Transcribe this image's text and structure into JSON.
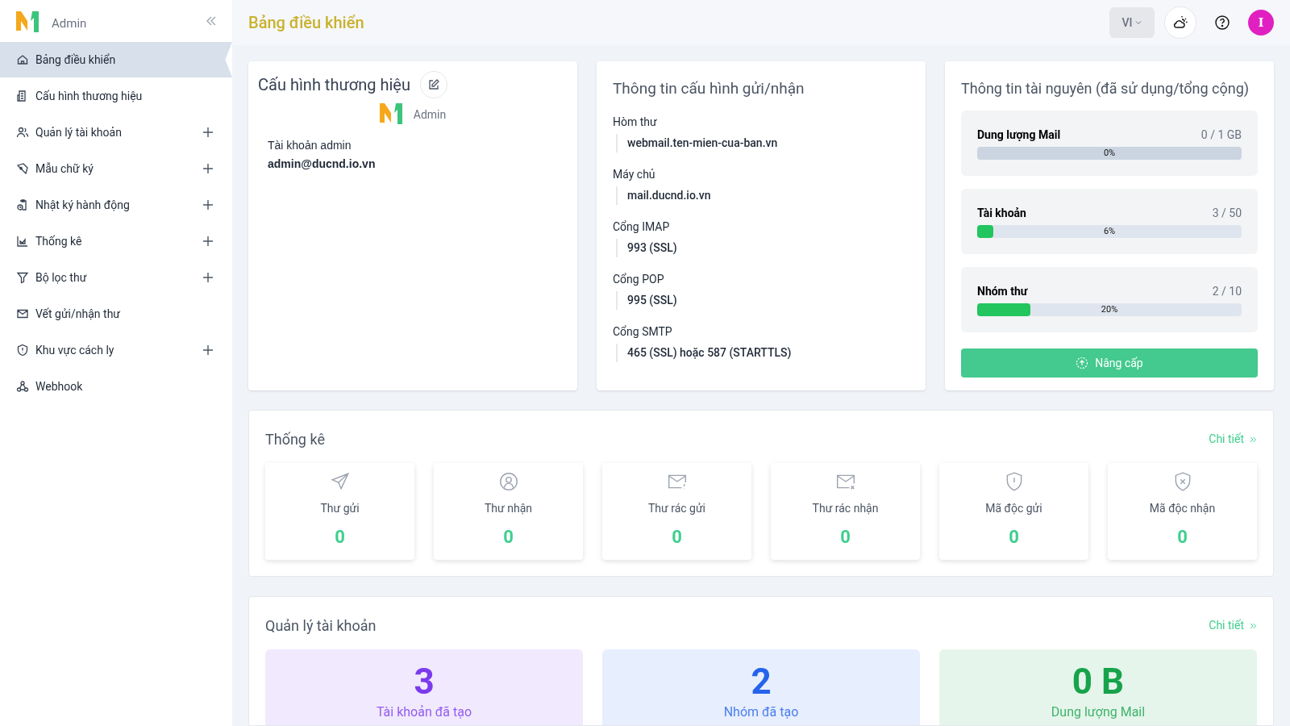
{
  "sidebar": {
    "logo_text": "Admin",
    "items": [
      {
        "label": "Bảng điều khiển",
        "selected": true,
        "expandable": false
      },
      {
        "label": "Cấu hình thương hiệu",
        "selected": false,
        "expandable": false
      },
      {
        "label": "Quản lý tài khoản",
        "selected": false,
        "expandable": true
      },
      {
        "label": "Mẫu chữ ký",
        "selected": false,
        "expandable": true
      },
      {
        "label": "Nhật ký hành động",
        "selected": false,
        "expandable": true
      },
      {
        "label": "Thống kê",
        "selected": false,
        "expandable": true
      },
      {
        "label": "Bộ lọc thư",
        "selected": false,
        "expandable": true
      },
      {
        "label": "Vết gửi/nhận thư",
        "selected": false,
        "expandable": false
      },
      {
        "label": "Khu vực cách ly",
        "selected": false,
        "expandable": true
      },
      {
        "label": "Webhook",
        "selected": false,
        "expandable": false
      }
    ]
  },
  "header": {
    "title": "Bảng điều khiển",
    "language": "VI",
    "avatar": "I"
  },
  "brand_card": {
    "title": "Cấu hình thương hiệu",
    "logo_text": "Admin",
    "account_label": "Tài khoản admin",
    "account_value": "admin@ducnd.io.vn"
  },
  "config_card": {
    "title": "Thông tin cấu hình gửi/nhận",
    "fields": [
      {
        "label": "Hòm thư",
        "value": "webmail.ten-mien-cua-ban.vn"
      },
      {
        "label": "Máy chủ",
        "value": "mail.ducnd.io.vn"
      },
      {
        "label": "Cổng IMAP",
        "value": "993 (SSL)"
      },
      {
        "label": "Cổng POP",
        "value": "995 (SSL)"
      },
      {
        "label": "Cổng SMTP",
        "value": "465 (SSL) hoặc 587 (STARTTLS)"
      }
    ]
  },
  "resources_card": {
    "title": "Thông tin tài nguyên (đã sử dụng/tổng cộng)",
    "items": [
      {
        "name": "Dung lượng Mail",
        "usage": "0 / 1 GB",
        "level": 0,
        "percent": "0%"
      },
      {
        "name": "Tài khoản",
        "usage": "3 / 50",
        "level": 0.06,
        "percent": "6%"
      },
      {
        "name": "Nhóm thư",
        "usage": "2 / 10",
        "level": 0.2,
        "percent": "20%"
      }
    ],
    "upgrade_button": "Nâng cấp"
  },
  "statistics": {
    "title": "Thống kê",
    "detail_link": "Chi tiết",
    "tiles": [
      {
        "label": "Thư gửi",
        "value": "0"
      },
      {
        "label": "Thư nhận",
        "value": "0"
      },
      {
        "label": "Thư rác gửi",
        "value": "0"
      },
      {
        "label": "Thư rác nhận",
        "value": "0"
      },
      {
        "label": "Mã độc gửi",
        "value": "0"
      },
      {
        "label": "Mã độc nhận",
        "value": "0"
      }
    ]
  },
  "account_management": {
    "title": "Quản lý tài khoản",
    "detail_link": "Chi tiết",
    "tiles": [
      {
        "value": "3",
        "label": "Tài khoản đã tạo",
        "color": "#7c3aed"
      },
      {
        "value": "2",
        "label": "Nhóm đã tạo",
        "color": "#2563eb"
      },
      {
        "value": "0 B",
        "label": "Dung lượng Mail",
        "color": "#16a34a"
      }
    ]
  }
}
